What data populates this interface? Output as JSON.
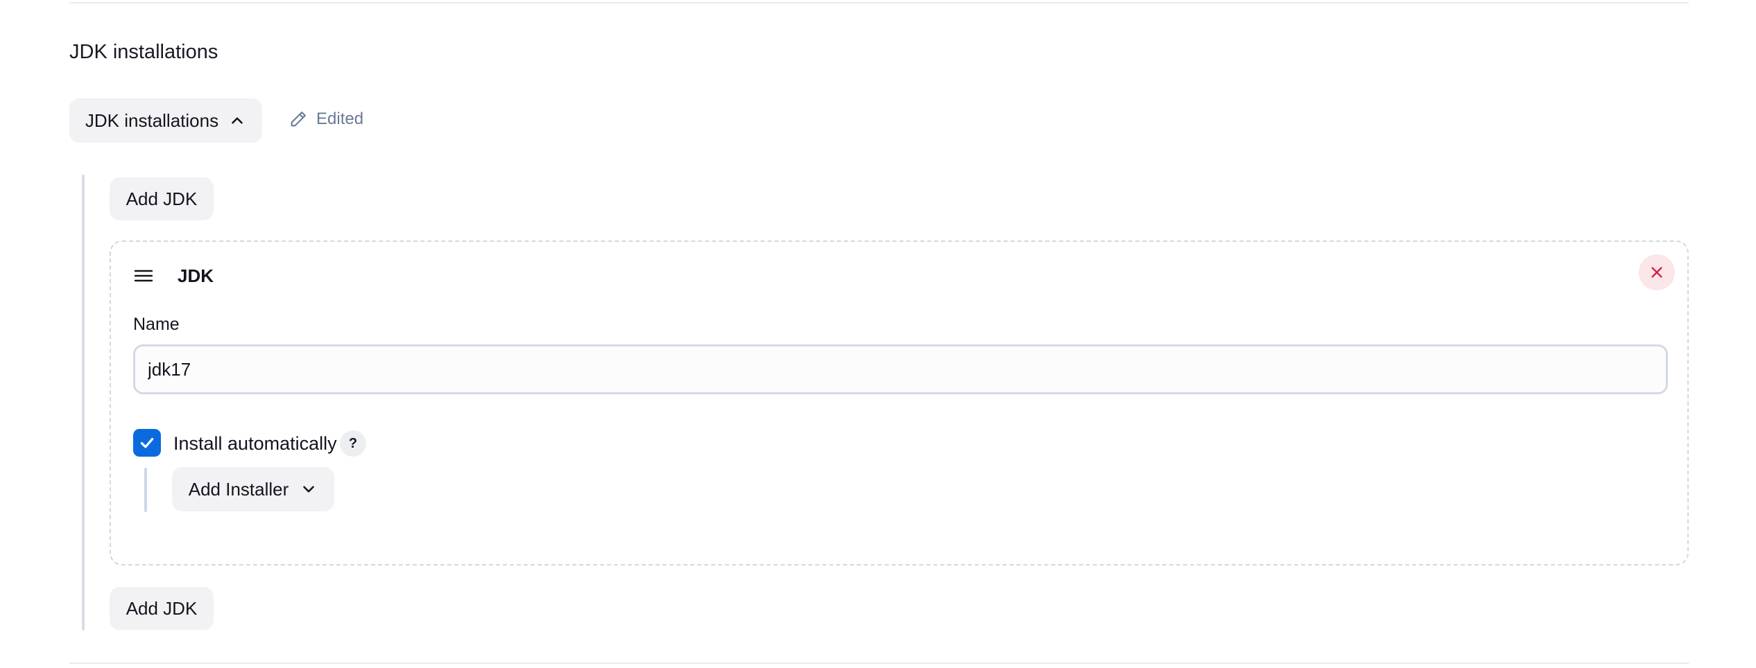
{
  "section": {
    "title": "JDK installations"
  },
  "toggle": {
    "label": "JDK installations",
    "icon": "chevron-up-icon"
  },
  "status": {
    "label": "Edited",
    "icon": "pencil-icon"
  },
  "add_jdk": {
    "label": "Add JDK"
  },
  "jdk_item": {
    "title": "JDK",
    "name_label": "Name",
    "name_value": "jdk17",
    "install_auto_label": "Install automatically",
    "install_auto_checked": true,
    "help_label": "?",
    "add_installer_label": "Add Installer"
  },
  "colors": {
    "accent": "#0b6bde",
    "danger": "#d61c3a",
    "muted": "#6b7a94"
  }
}
